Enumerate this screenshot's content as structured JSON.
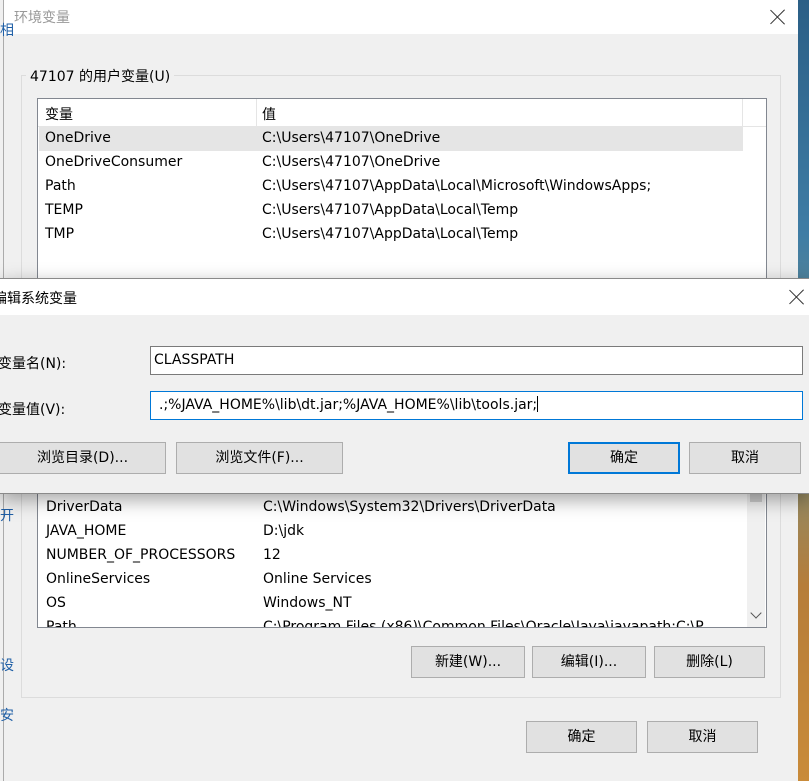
{
  "main_window": {
    "title": "环境变量",
    "user_group": {
      "label": "47107 的用户变量(U)",
      "columns": [
        "变量",
        "值"
      ],
      "rows": [
        {
          "name": "OneDrive",
          "value": "C:\\Users\\47107\\OneDrive",
          "selected": true
        },
        {
          "name": "OneDriveConsumer",
          "value": "C:\\Users\\47107\\OneDrive",
          "selected": false
        },
        {
          "name": "Path",
          "value": "C:\\Users\\47107\\AppData\\Local\\Microsoft\\WindowsApps;",
          "selected": false
        },
        {
          "name": "TEMP",
          "value": "C:\\Users\\47107\\AppData\\Local\\Temp",
          "selected": false
        },
        {
          "name": "TMP",
          "value": "C:\\Users\\47107\\AppData\\Local\\Temp",
          "selected": false
        }
      ]
    },
    "system_group": {
      "rows": [
        {
          "name": "DriverData",
          "value": "C:\\Windows\\System32\\Drivers\\DriverData"
        },
        {
          "name": "JAVA_HOME",
          "value": "D:\\jdk"
        },
        {
          "name": "NUMBER_OF_PROCESSORS",
          "value": "12"
        },
        {
          "name": "OnlineServices",
          "value": "Online Services"
        },
        {
          "name": "OS",
          "value": "Windows_NT"
        },
        {
          "name": "Path",
          "value": "C:\\Program Files (x86)\\Common Files\\Oracle\\Java\\javapath;C:\\P"
        }
      ],
      "new_button": "新建(W)...",
      "edit_button": "编辑(I)...",
      "delete_button": "删除(L)"
    },
    "ok_button": "确定",
    "cancel_button": "取消",
    "left_edge_glyphs": [
      "相",
      "开",
      "设",
      "安"
    ]
  },
  "edit_dialog": {
    "title": "编辑系统变量",
    "name_label": "变量名(N):",
    "name_value": "CLASSPATH",
    "value_label": "变量值(V):",
    "value_value": ".;%JAVA_HOME%\\lib\\dt.jar;%JAVA_HOME%\\lib\\tools.jar;",
    "browse_dir_button": "浏览目录(D)...",
    "browse_file_button": "浏览文件(F)...",
    "ok_button": "确定",
    "cancel_button": "取消"
  },
  "icons": {
    "close": "close-icon",
    "scroll_down": "chevron-down-icon"
  },
  "colors": {
    "accent": "#0078d7",
    "selection": "#e5e5e5"
  }
}
